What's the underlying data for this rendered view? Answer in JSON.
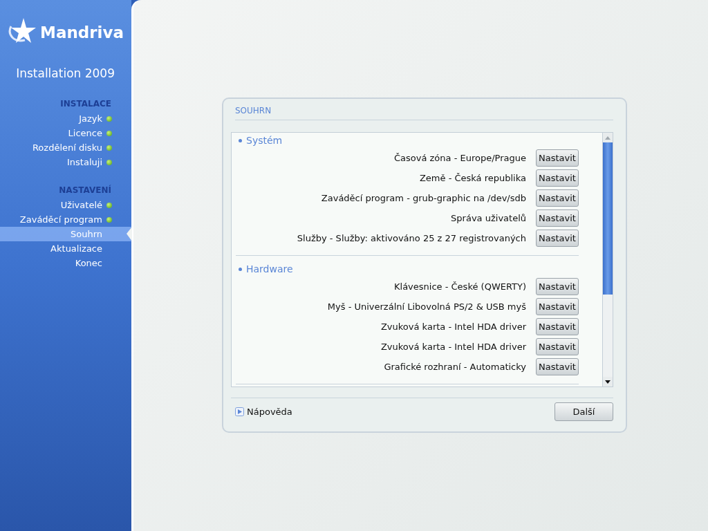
{
  "logo": {
    "name": "Mandriva",
    "subtitle": "Installation 2009"
  },
  "sidebar": {
    "sections": [
      {
        "title": "INSTALACE",
        "items": [
          {
            "label": "Jazyk",
            "done": true,
            "selected": false
          },
          {
            "label": "Licence",
            "done": true,
            "selected": false
          },
          {
            "label": "Rozdělení disku",
            "done": true,
            "selected": false
          },
          {
            "label": "Instaluji",
            "done": true,
            "selected": false
          }
        ]
      },
      {
        "title": "NASTAVENÍ",
        "items": [
          {
            "label": "Uživatelé",
            "done": true,
            "selected": false
          },
          {
            "label": "Zaváděcí program",
            "done": true,
            "selected": false
          },
          {
            "label": "Souhrn",
            "done": false,
            "selected": true
          },
          {
            "label": "Aktualizace",
            "done": false,
            "selected": false
          },
          {
            "label": "Konec",
            "done": false,
            "selected": false
          }
        ]
      }
    ]
  },
  "panel": {
    "title": "SOUHRN",
    "groups": [
      {
        "title": "Systém",
        "rows": [
          {
            "label": "Časová zóna - Europe/Prague",
            "button": "Nastavit"
          },
          {
            "label": "Země - Česká republika",
            "button": "Nastavit"
          },
          {
            "label": "Zaváděcí program - grub-graphic na /dev/sdb",
            "button": "Nastavit"
          },
          {
            "label": "Správa uživatelů",
            "button": "Nastavit"
          },
          {
            "label": "Služby - Služby: aktivováno 25 z 27 registrovaných",
            "button": "Nastavit"
          }
        ]
      },
      {
        "title": "Hardware",
        "rows": [
          {
            "label": "Klávesnice - České (QWERTY)",
            "button": "Nastavit"
          },
          {
            "label": "Myš - Univerzální Libovolná PS/2 & USB myš",
            "button": "Nastavit"
          },
          {
            "label": "Zvuková karta - Intel HDA driver",
            "button": "Nastavit"
          },
          {
            "label": "Zvuková karta - Intel HDA driver",
            "button": "Nastavit"
          },
          {
            "label": "Grafické rozhraní - Automaticky",
            "button": "Nastavit"
          }
        ]
      }
    ],
    "help": "Nápověda",
    "next": "Další"
  }
}
